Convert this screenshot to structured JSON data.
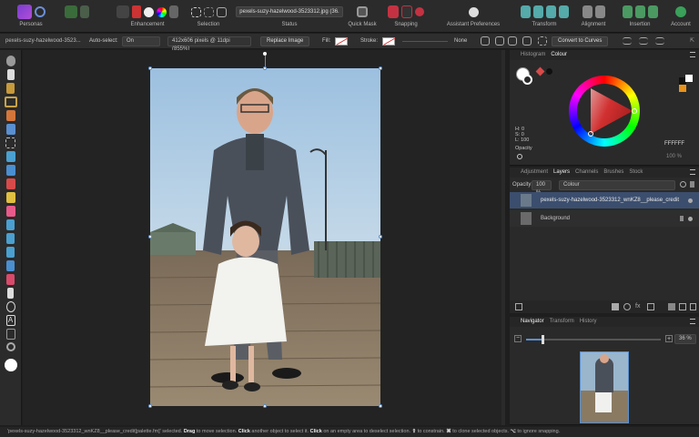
{
  "app": {
    "accent": "#8a3fd0"
  },
  "toolbar_top": {
    "personas_label": "Personas",
    "enhancement_label": "Enhancement",
    "selection_label": "Selection",
    "status_label": "Status",
    "filename_pill": "pexels-suzy-hazelwood-3523312.jpg (36.",
    "quick_mask_label": "Quick Mask",
    "snapping_label": "Snapping",
    "assistant_label": "Assistant Preferences",
    "transform_label": "Transform",
    "alignment_label": "Alignment",
    "insertion_label": "Insertion",
    "account_label": "Account"
  },
  "context_bar": {
    "filename": "pexels-suzy-hazelwood-3523...",
    "auto_select_label": "Auto-select:",
    "auto_select_value": "On",
    "image_info": "412x606 pixels @ 11dpi (855%)",
    "replace_button": "Replace Image",
    "fill_label": "Fill:",
    "stroke_label": "Stroke:",
    "stroke_value": "None",
    "convert_button": "Convert to Curves"
  },
  "colour_panel": {
    "tabs": [
      "Histogram",
      "Colour"
    ],
    "active_tab": "Colour",
    "h": "H: 0",
    "s": "S: 0",
    "l": "L: 100",
    "opacity_label": "Opacity",
    "hex": "FFFFFF",
    "opacity_value": "100 %"
  },
  "layers_panel": {
    "tabs": [
      "Adjustment",
      "Layers",
      "Channels",
      "Brushes",
      "Stock"
    ],
    "active_tab": "Layers",
    "opacity_label": "Opacity:",
    "opacity_value": "100 %",
    "blend_mode": "Colour",
    "layers": [
      {
        "name": "pexels-suzy-hazelwood-3523312_wnKZ8__please_credit..."
      },
      {
        "name": "Background"
      }
    ]
  },
  "navigator_panel": {
    "tabs": [
      "Navigator",
      "Transform",
      "History"
    ],
    "active_tab": "Navigator",
    "zoom_value": "36 %"
  },
  "status_bar": {
    "layer_text": "'pexels-suzy-hazelwood-3523312_wnKZ8__please_credit[palette.fm]' selected.",
    "drag": "Drag",
    "drag_text": "to move selection.",
    "click": "Click",
    "click_text": "another object to select it.",
    "click2": "Click",
    "click2_text": "on an empty area to deselect selection.",
    "shift": "⇧",
    "shift_text": "to constrain.",
    "cmd": "⌘",
    "cmd_text": "to clone selected objects.",
    "opt": "⌥",
    "opt_text": "to ignore snapping."
  }
}
